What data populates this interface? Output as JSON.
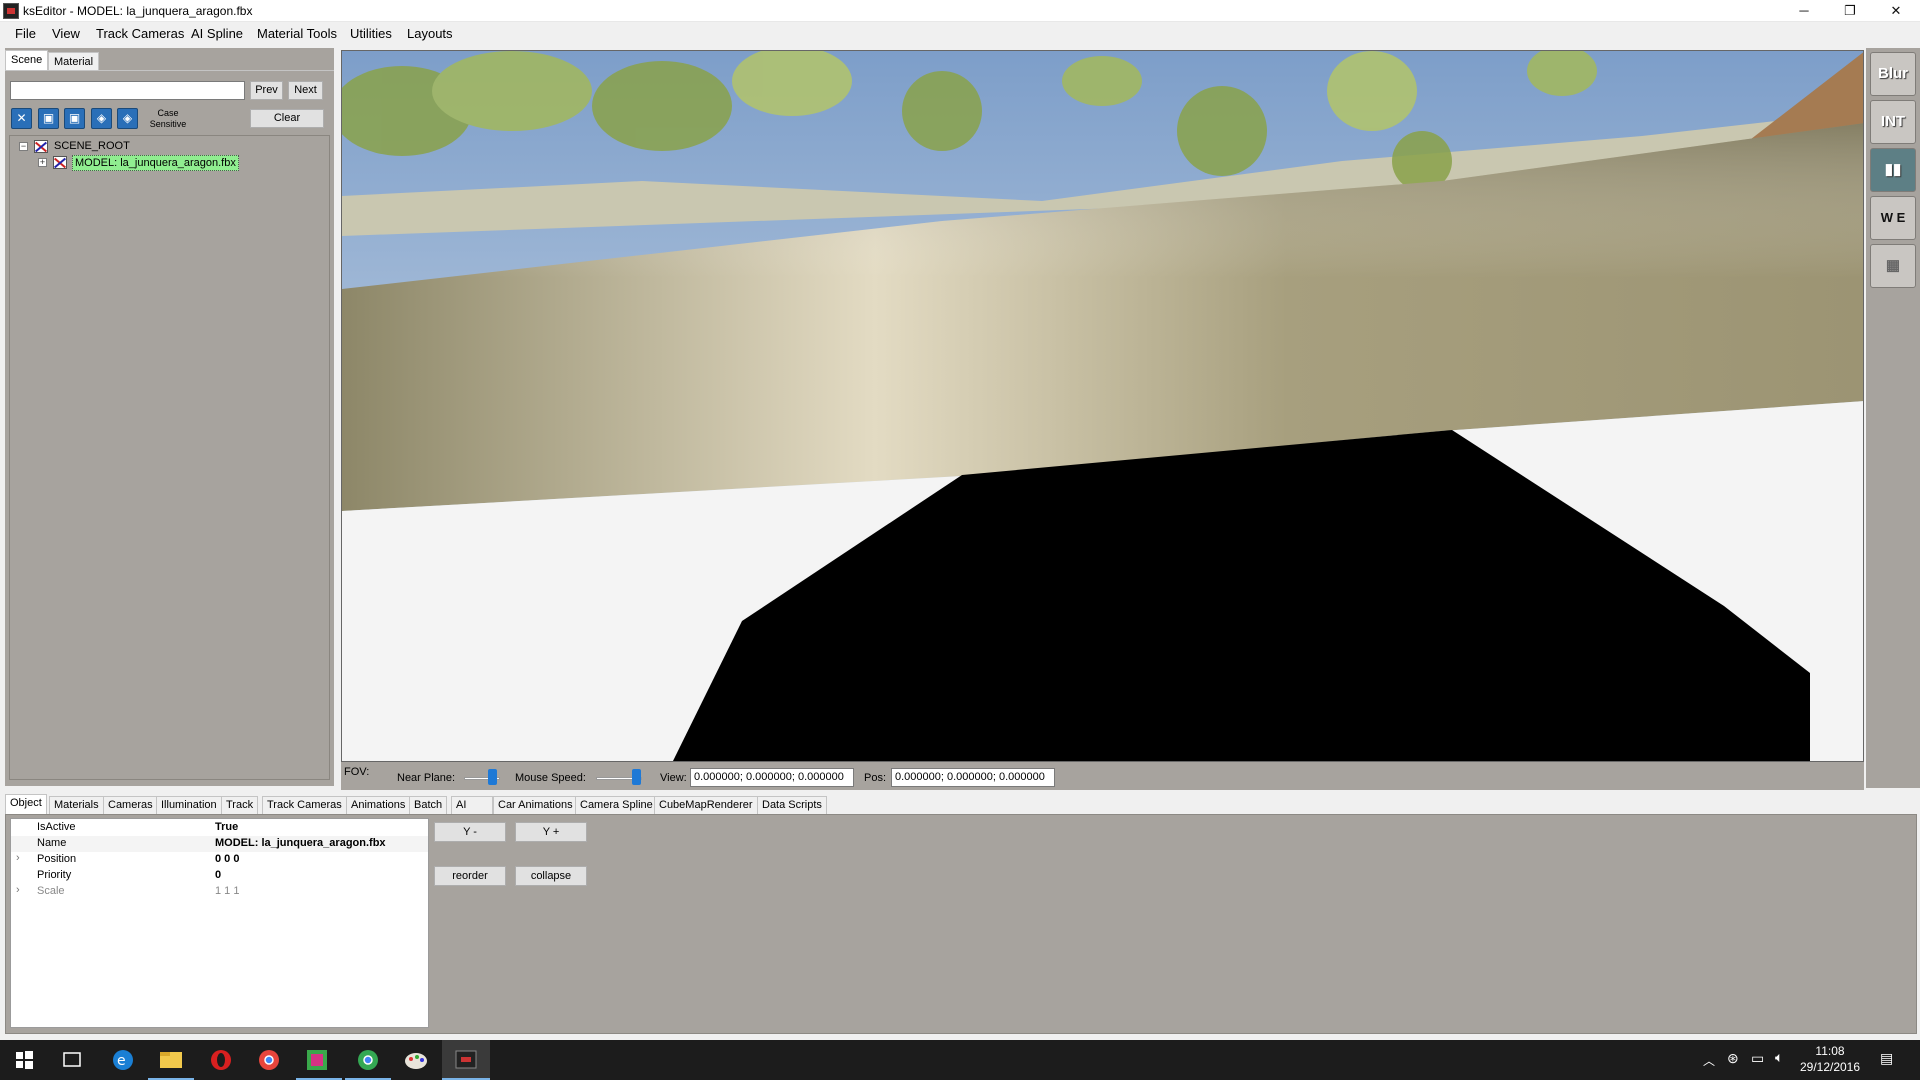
{
  "window": {
    "title": "ksEditor - MODEL: la_junquera_aragon.fbx",
    "minimize_glyph": "─",
    "restore_glyph": "❐",
    "close_glyph": "✕"
  },
  "menu": [
    "File",
    "View",
    "Track Cameras",
    "AI Spline",
    "Material Tools",
    "Utilities",
    "Layouts"
  ],
  "left_panel": {
    "tabs": [
      "Scene",
      "Material"
    ],
    "active_tab": "Scene",
    "search": {
      "value": "",
      "placeholder": ""
    },
    "prev_label": "Prev",
    "next_label": "Next",
    "filter_icons": [
      "x-filter-icon",
      "cube-filter-icon",
      "cube-filter-2-icon",
      "cube-filter-3-icon",
      "cube-filter-4-icon"
    ],
    "case_sensitive_label_1": "Case",
    "case_sensitive_label_2": "Sensitive",
    "clear_label": "Clear",
    "tree": {
      "root": {
        "label": "SCENE_ROOT",
        "toggle": "−"
      },
      "child": {
        "label": "MODEL: la_junquera_aragon.fbx",
        "toggle": "+",
        "selected": true
      }
    }
  },
  "right_toolbar": [
    {
      "name": "blur-button",
      "label": "Blur"
    },
    {
      "name": "int-hr-lr-button",
      "label": "INT"
    },
    {
      "name": "panels-button",
      "label": ""
    },
    {
      "name": "wind-we-button",
      "label": "W E"
    },
    {
      "name": "grid-button",
      "label": ""
    }
  ],
  "controls": {
    "fov_label": "FOV:",
    "near_plane_label": "Near Plane:",
    "mouse_speed_label": "Mouse Speed:",
    "view_label": "View:",
    "view_value": "0.000000; 0.000000; 0.000000",
    "pos_label": "Pos:",
    "pos_value": "0.000000; 0.000000; 0.000000"
  },
  "bottom_tabs": [
    "Object",
    "Materials",
    "Cameras",
    "Illumination",
    "Track",
    "Track Cameras",
    "Animations",
    "Batch",
    "AI",
    "Car Animations",
    "Camera Spline",
    "CubeMapRenderer",
    "Data Scripts"
  ],
  "active_bottom_tab": "Object",
  "properties": [
    {
      "name": "IsActive",
      "value": "True",
      "expandable": false
    },
    {
      "name": "Name",
      "value": "MODEL: la_junquera_aragon.fbx",
      "expandable": false
    },
    {
      "name": "Position",
      "value": "0 0 0",
      "expandable": true
    },
    {
      "name": "Priority",
      "value": "0",
      "expandable": false
    },
    {
      "name": "Scale",
      "value": "1 1 1",
      "expandable": true,
      "disabled": true
    }
  ],
  "object_buttons": {
    "y_minus": "Y -",
    "y_plus": "Y +",
    "reorder": "reorder",
    "collapse": "collapse"
  },
  "taskbar": {
    "time": "11:08",
    "date": "29/12/2016",
    "pinned": [
      "windows-start-icon",
      "task-view-icon",
      "edge-icon",
      "file-explorer-icon",
      "opera-icon",
      "chrome-icon",
      "app-green-icon",
      "chrome-variant-icon",
      "paint-icon",
      "kseditor-icon"
    ],
    "tray": [
      "chevron-up-icon",
      "steam-icon",
      "network-icon",
      "volume-icon",
      "notification-icon"
    ]
  },
  "colors": {
    "panel": "#a7a39e",
    "selected_tree": "#90ee90",
    "accent": "#1e79d6",
    "taskbar": "#1c1c1c"
  }
}
